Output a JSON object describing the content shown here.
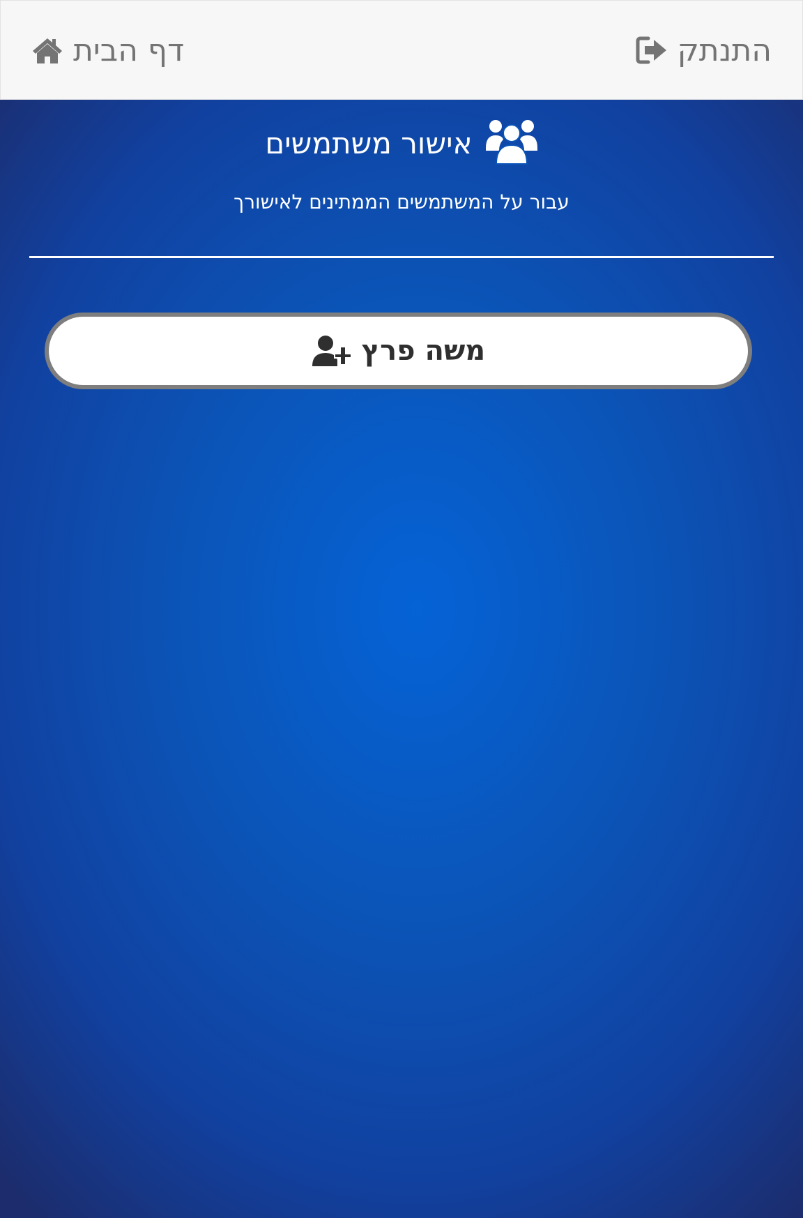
{
  "topbar": {
    "logout_label": "התנתק",
    "logout_icon": "sign-out-icon",
    "home_label": "דף הבית",
    "home_icon": "home-icon"
  },
  "header": {
    "title": "אישור משתמשים",
    "title_icon": "users-icon",
    "subtitle": "עבור על המשתמשים הממתינים לאישורך"
  },
  "pending_users": [
    {
      "name": "משה פרץ",
      "icon": "user-plus-icon"
    }
  ],
  "colors": {
    "background": "#0b54b7",
    "topbar": "#f7f7f7",
    "nav_text": "#747474",
    "button_bg": "#ffffff",
    "button_border": "#7e7e7e",
    "button_text": "#2f2f2f"
  }
}
